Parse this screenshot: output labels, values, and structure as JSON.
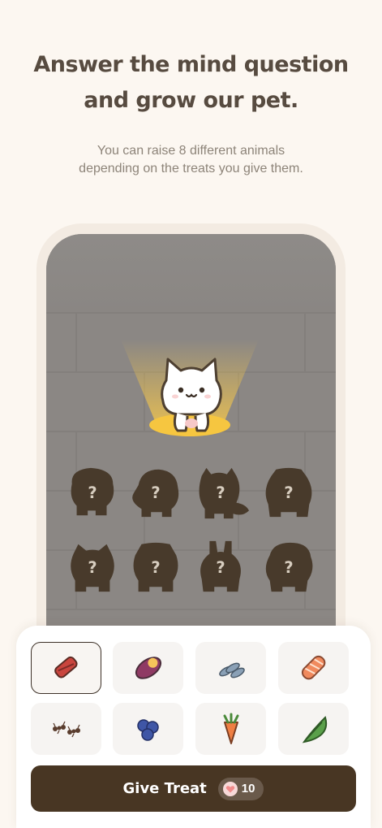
{
  "header": {
    "title_line1": "Answer the mind question",
    "title_line2": "and grow our pet.",
    "subtitle_line1": "You can raise 8 different animals",
    "subtitle_line2": "depending on the treats you give them."
  },
  "pet_slots": [
    {
      "label": "?",
      "animal": "bear-silhouette"
    },
    {
      "label": "?",
      "animal": "chick-silhouette"
    },
    {
      "label": "?",
      "animal": "squirrel-silhouette"
    },
    {
      "label": "?",
      "animal": "hamster-silhouette"
    },
    {
      "label": "?",
      "animal": "cat-silhouette"
    },
    {
      "label": "?",
      "animal": "dog-silhouette"
    },
    {
      "label": "?",
      "animal": "rabbit-silhouette"
    },
    {
      "label": "?",
      "animal": "duck-silhouette"
    }
  ],
  "treats": [
    {
      "icon": "jerky-icon",
      "selected": true
    },
    {
      "icon": "sweet-potato-icon",
      "selected": false
    },
    {
      "icon": "fish-icon",
      "selected": false
    },
    {
      "icon": "salmon-icon",
      "selected": false
    },
    {
      "icon": "ants-icon",
      "selected": false
    },
    {
      "icon": "blueberries-icon",
      "selected": false
    },
    {
      "icon": "carrot-icon",
      "selected": false
    },
    {
      "icon": "leaf-greens-icon",
      "selected": false
    }
  ],
  "action": {
    "label": "Give Treat",
    "cost": "10",
    "cost_icon": "heart-icon"
  },
  "colors": {
    "background": "#fcf7f1",
    "silhouette": "#483a2b",
    "button": "#483623",
    "spotlight": "#f7c84a"
  }
}
